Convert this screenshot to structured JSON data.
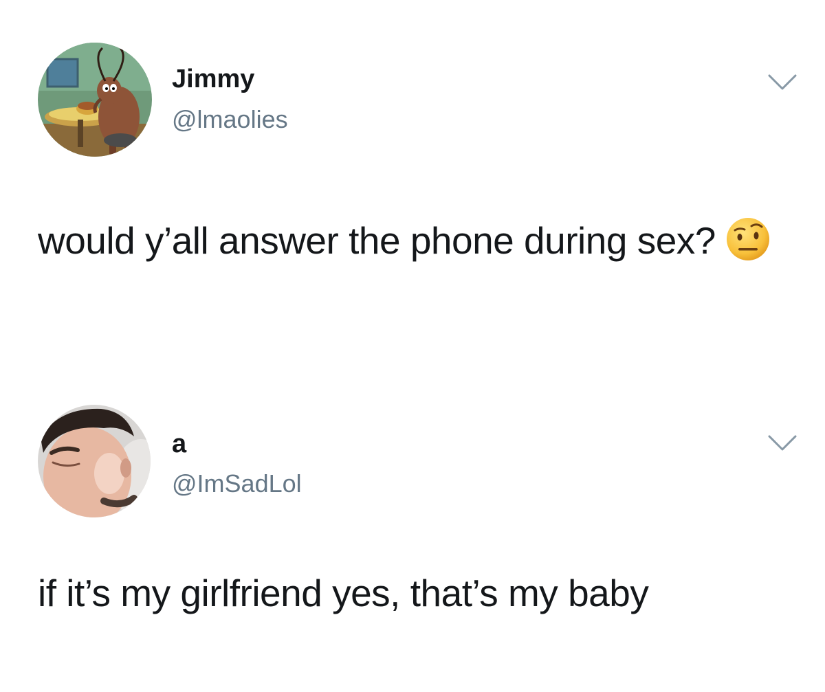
{
  "tweets": [
    {
      "display_name": "Jimmy",
      "handle": "@lmaolies",
      "text": "would y’all answer the phone during sex?",
      "emoji": "🤨",
      "avatar_icon": "cartoon-cockroach-avatar",
      "menu_icon": "chevron-down-icon"
    },
    {
      "display_name": "a",
      "handle": "@ImSadLol",
      "text": "if it’s my girlfriend yes, that’s my baby",
      "avatar_icon": "face-photo-avatar",
      "menu_icon": "chevron-down-icon"
    }
  ],
  "colors": {
    "text": "#14171a",
    "secondary_text": "#657786",
    "chevron": "#8899a6",
    "background": "#ffffff"
  }
}
